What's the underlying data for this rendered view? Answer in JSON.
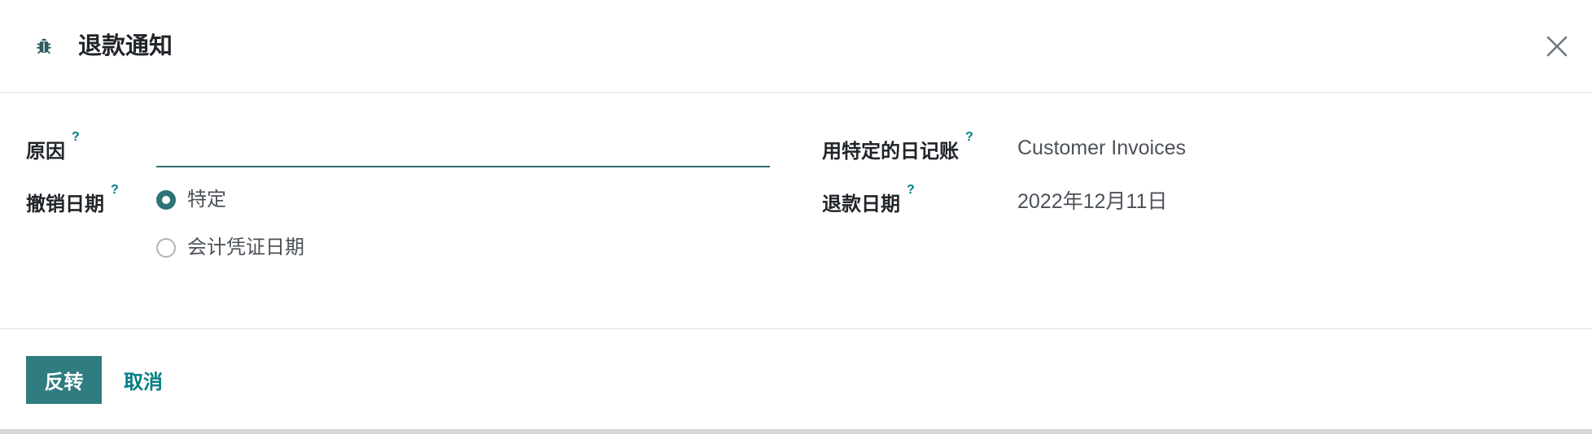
{
  "dialog": {
    "title": "退款通知",
    "header_icon": "bug-icon",
    "close_icon": "close-icon"
  },
  "form": {
    "help_marker": "?",
    "reason": {
      "label": "原因",
      "value": ""
    },
    "reversal_date": {
      "label": "撤销日期",
      "options": [
        {
          "label": "特定",
          "selected": true
        },
        {
          "label": "会计凭证日期",
          "selected": false
        }
      ]
    },
    "journal": {
      "label": "用特定的日记账",
      "value": "Customer Invoices"
    },
    "refund_date": {
      "label": "退款日期",
      "value": "2022年12月11日"
    }
  },
  "footer": {
    "reverse_label": "反转",
    "cancel_label": "取消"
  },
  "colors": {
    "primary": "#2f7d81",
    "link": "#017e84",
    "input_underline": "#2f6f75"
  }
}
